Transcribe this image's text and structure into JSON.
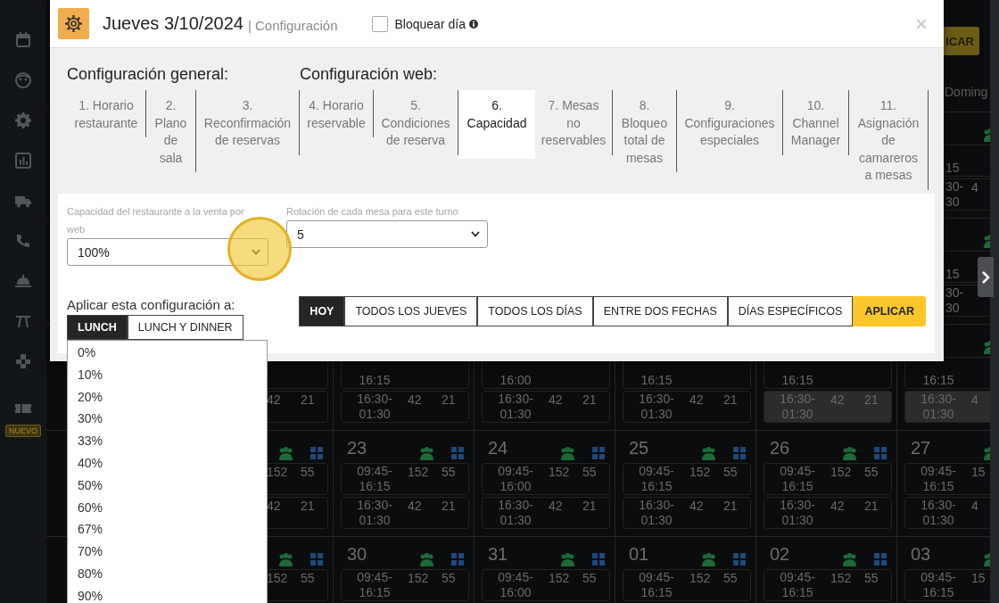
{
  "sidebar": {
    "badge": "NUEVO"
  },
  "top_button": "ICAR",
  "calendar": {
    "header": "Doming",
    "rows": [
      {
        "cells": [
          {
            "kind": "empty"
          },
          {
            "kind": "empty"
          },
          {
            "kind": "empty"
          },
          {
            "kind": "empty"
          },
          {
            "kind": "empty"
          },
          {
            "kind": "empty"
          },
          {
            "kind": "edge",
            "slots": [
              {
                "time": "15",
                "shaded": false
              },
              {
                "time": "30-\n30",
                "a": "4",
                "shaded": false
              }
            ]
          }
        ]
      },
      {
        "cells": [
          {
            "kind": "empty"
          },
          {
            "kind": "empty"
          },
          {
            "kind": "empty"
          },
          {
            "kind": "empty"
          },
          {
            "kind": "empty"
          },
          {
            "kind": "empty"
          },
          {
            "kind": "edge",
            "slots": [
              {
                "time": "15",
                "shaded": false
              },
              {
                "time": "30-\n30",
                "shaded": false
              }
            ]
          }
        ]
      },
      {
        "cells": [
          {
            "kind": "empty"
          },
          {
            "kind": "covered",
            "slots": [
              {
                "shaded": false
              },
              {
                "a": "42",
                "b": "21",
                "shaded": false
              }
            ]
          },
          {
            "kind": "covered",
            "slots": [
              {
                "time": "16:15",
                "shaded": false
              },
              {
                "time": "16:30-\n01:30",
                "a": "42",
                "b": "21",
                "shaded": false
              }
            ]
          },
          {
            "kind": "covered",
            "slots": [
              {
                "time": "16:00",
                "shaded": false
              },
              {
                "time": "16:30-\n01:30",
                "a": "42",
                "b": "21",
                "shaded": false
              }
            ]
          },
          {
            "kind": "covered",
            "slots": [
              {
                "time": "16:15",
                "shaded": false
              },
              {
                "time": "16:30-\n01:30",
                "a": "42",
                "b": "21",
                "shaded": false
              }
            ]
          },
          {
            "kind": "covered",
            "slots": [
              {
                "time": "16:15",
                "shaded": false
              },
              {
                "time": "16:30-\n01:30",
                "a": "42",
                "b": "21",
                "shaded": true
              }
            ]
          },
          {
            "kind": "day",
            "slots": [
              {
                "time": "16:15",
                "shaded": false
              },
              {
                "time": "16:30-\n01:30",
                "a": "4",
                "shaded": true
              }
            ]
          }
        ]
      },
      {
        "cells": [
          {
            "kind": "empty"
          },
          {
            "kind": "day",
            "slots": [
              {
                "a": "152",
                "b": "55",
                "shaded": false
              },
              {
                "a": "42",
                "b": "21",
                "shaded": false
              }
            ]
          },
          {
            "kind": "day",
            "day": "23",
            "slots": [
              {
                "time": "09:45-\n16:15",
                "a": "152",
                "b": "55",
                "shaded": false
              },
              {
                "time": "16:30-\n01:30",
                "a": "42",
                "b": "21",
                "shaded": false
              }
            ]
          },
          {
            "kind": "day",
            "day": "24",
            "slots": [
              {
                "time": "09:45-\n16:00",
                "a": "152",
                "b": "55",
                "shaded": false
              },
              {
                "time": "16:30-\n01:30",
                "a": "42",
                "b": "21",
                "shaded": false
              }
            ]
          },
          {
            "kind": "day",
            "day": "25",
            "slots": [
              {
                "time": "09:45-\n16:15",
                "a": "152",
                "b": "55",
                "shaded": false
              },
              {
                "time": "16:30-\n01:30",
                "a": "42",
                "b": "21",
                "shaded": false
              }
            ]
          },
          {
            "kind": "day",
            "day": "26",
            "slots": [
              {
                "time": "09:45-\n16:15",
                "a": "152",
                "b": "55",
                "shaded": false
              },
              {
                "time": "16:30-\n01:30",
                "a": "42",
                "b": "21",
                "shaded": false
              }
            ]
          },
          {
            "kind": "day",
            "day": "27",
            "slots": [
              {
                "time": "09:45-\n16:15",
                "a": "15",
                "shaded": false
              },
              {
                "time": "16:30-\n01:30",
                "a": "4",
                "shaded": false
              }
            ]
          }
        ]
      },
      {
        "cells": [
          {
            "kind": "empty"
          },
          {
            "kind": "day",
            "slots": [
              {
                "a": "152",
                "b": "55",
                "shaded": false
              }
            ]
          },
          {
            "kind": "day",
            "day": "30",
            "slots": [
              {
                "time": "09:45-\n16:15",
                "a": "152",
                "b": "55",
                "shaded": false
              }
            ]
          },
          {
            "kind": "day",
            "day": "31",
            "slots": [
              {
                "time": "09:45-\n16:00",
                "a": "152",
                "b": "55",
                "shaded": false
              }
            ]
          },
          {
            "kind": "day",
            "day": "01",
            "slots": [
              {
                "time": "09:45-\n16:15",
                "a": "152",
                "b": "55",
                "shaded": false
              }
            ]
          },
          {
            "kind": "day",
            "day": "02",
            "slots": [
              {
                "time": "09:45-\n16:15",
                "a": "152",
                "b": "55",
                "shaded": false
              }
            ]
          },
          {
            "kind": "day",
            "day": "03",
            "slots": [
              {
                "time": "09:45-\n16:15",
                "a": "15",
                "shaded": false
              }
            ]
          }
        ]
      }
    ]
  },
  "modal": {
    "close": "×",
    "title": "Jueves 3/10/2024",
    "subtitle": "| Configuración",
    "block_day": {
      "label": "Bloquear día",
      "checked": false
    },
    "groups": [
      {
        "heading": "Configuración general:",
        "tabs": [
          {
            "label": "1. Horario\nrestaurante",
            "selected": false
          },
          {
            "label": "2.\nPlano\nde\nsala",
            "selected": false
          },
          {
            "label": "3.\nReconfirmación\nde reservas",
            "selected": false
          }
        ]
      },
      {
        "heading": "Configuración web:",
        "tabs": [
          {
            "label": "4. Horario\nreservable",
            "selected": false
          },
          {
            "label": "5.\nCondiciones\nde reserva",
            "selected": false
          },
          {
            "label": "6.\nCapacidad",
            "selected": true
          },
          {
            "label": "7. Mesas\nno\nreservables",
            "selected": false
          },
          {
            "label": "8.\nBloqueo\ntotal de\nmesas",
            "selected": false
          },
          {
            "label": "9.\nConfiguraciones\nespeciales",
            "selected": false
          },
          {
            "label": "10.\nChannel\nManager",
            "selected": false
          },
          {
            "label": "11.\nAsignación\nde\ncamareros\na mesas",
            "selected": false
          }
        ]
      }
    ],
    "fields": [
      {
        "label": "Capacidad del restaurante a la venta por web",
        "value": "100%"
      },
      {
        "label": "Rotación de cada mesa para este turno",
        "value": "5"
      }
    ],
    "apply_label": "Aplicar esta configuración a:",
    "shifts": [
      {
        "label": "LUNCH",
        "selected": true
      },
      {
        "label": "LUNCH Y DINNER",
        "selected": false
      }
    ],
    "scopes": [
      {
        "label": "HOY",
        "selected": true
      },
      {
        "label": "TODOS LOS JUEVES",
        "selected": false
      },
      {
        "label": "TODOS LOS DÍAS",
        "selected": false
      },
      {
        "label": "ENTRE DOS FECHAS",
        "selected": false
      },
      {
        "label": "DÍAS ESPECÍFICOS",
        "selected": false
      }
    ],
    "apply_button": "APLICAR",
    "dropdown": {
      "options": [
        "0%",
        "10%",
        "20%",
        "30%",
        "33%",
        "40%",
        "50%",
        "60%",
        "67%",
        "70%",
        "80%",
        "90%"
      ]
    }
  }
}
